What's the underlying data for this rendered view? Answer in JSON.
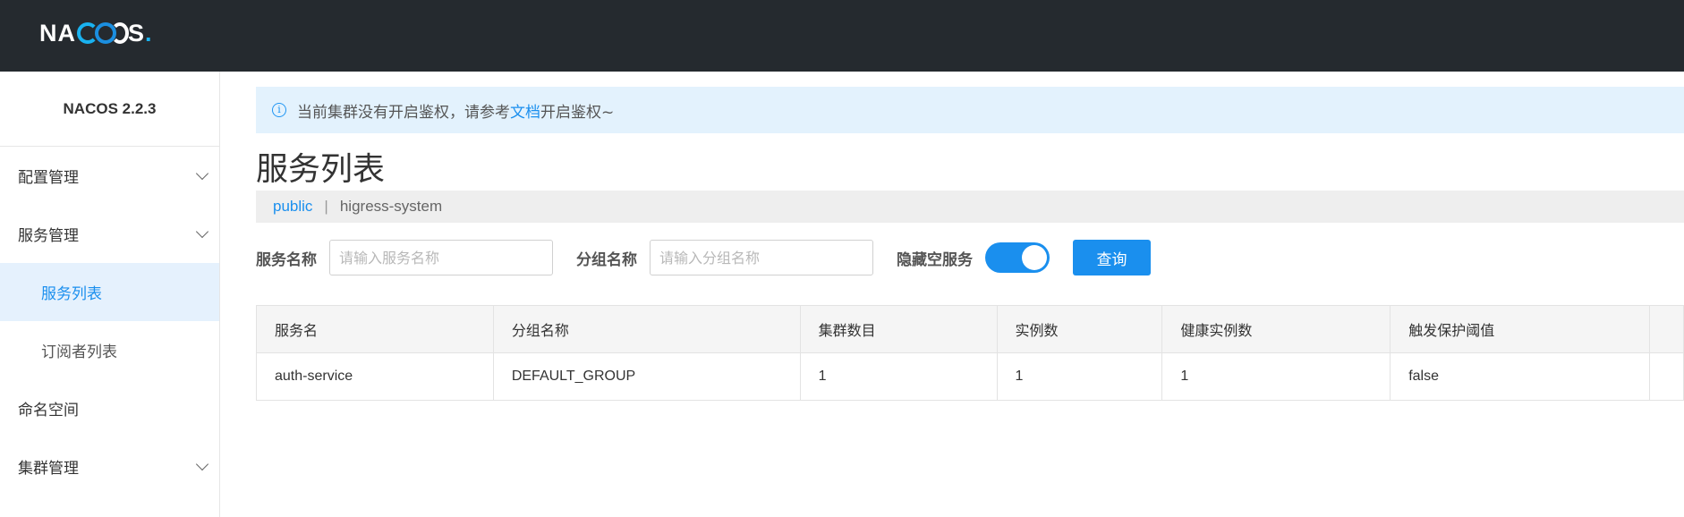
{
  "brand": {
    "logo_prefix": "NA",
    "logo_suffix": "S",
    "logo_dot": "."
  },
  "sidebar": {
    "version": "NACOS 2.2.3",
    "items": [
      {
        "label": "配置管理",
        "expandable": true
      },
      {
        "label": "服务管理",
        "expandable": true
      },
      {
        "label": "服务列表",
        "sub": true,
        "active": true
      },
      {
        "label": "订阅者列表",
        "sub": true
      },
      {
        "label": "命名空间",
        "expandable": false
      },
      {
        "label": "集群管理",
        "expandable": true
      }
    ]
  },
  "notice": {
    "icon": "info-icon",
    "text_before": "当前集群没有开启鉴权，请参考",
    "link": "文档",
    "text_after": "开启鉴权~"
  },
  "page": {
    "title": "服务列表"
  },
  "namespaces": {
    "items": [
      "public",
      "higress-system"
    ],
    "separator": "|"
  },
  "filters": {
    "service_label": "服务名称",
    "service_placeholder": "请输入服务名称",
    "group_label": "分组名称",
    "group_placeholder": "请输入分组名称",
    "hide_empty_label": "隐藏空服务",
    "hide_empty_on": true,
    "query_button": "查询"
  },
  "table": {
    "columns": [
      "服务名",
      "分组名称",
      "集群数目",
      "实例数",
      "健康实例数",
      "触发保护阈值"
    ],
    "rows": [
      [
        "auth-service",
        "DEFAULT_GROUP",
        "1",
        "1",
        "1",
        "false"
      ]
    ]
  },
  "colors": {
    "accent": "#1a8fee",
    "topbar": "#252a2f",
    "notice_bg": "#e3f2fd"
  }
}
